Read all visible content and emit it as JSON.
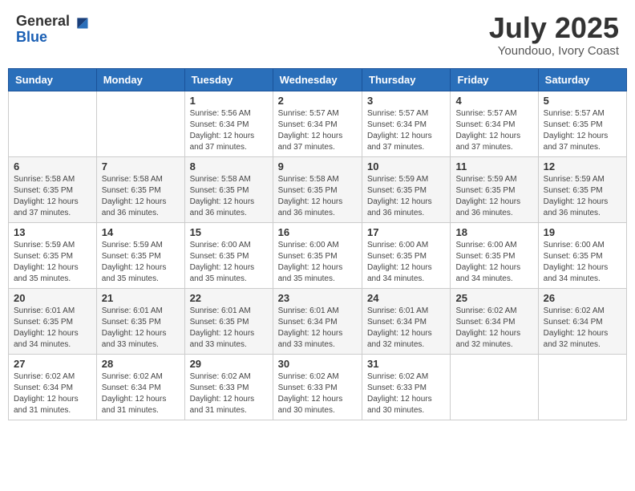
{
  "header": {
    "logo_general": "General",
    "logo_blue": "Blue",
    "month_title": "July 2025",
    "subtitle": "Youndouo, Ivory Coast"
  },
  "days_of_week": [
    "Sunday",
    "Monday",
    "Tuesday",
    "Wednesday",
    "Thursday",
    "Friday",
    "Saturday"
  ],
  "weeks": [
    [
      {
        "day": "",
        "info": ""
      },
      {
        "day": "",
        "info": ""
      },
      {
        "day": "1",
        "info": "Sunrise: 5:56 AM\nSunset: 6:34 PM\nDaylight: 12 hours and 37 minutes."
      },
      {
        "day": "2",
        "info": "Sunrise: 5:57 AM\nSunset: 6:34 PM\nDaylight: 12 hours and 37 minutes."
      },
      {
        "day": "3",
        "info": "Sunrise: 5:57 AM\nSunset: 6:34 PM\nDaylight: 12 hours and 37 minutes."
      },
      {
        "day": "4",
        "info": "Sunrise: 5:57 AM\nSunset: 6:34 PM\nDaylight: 12 hours and 37 minutes."
      },
      {
        "day": "5",
        "info": "Sunrise: 5:57 AM\nSunset: 6:35 PM\nDaylight: 12 hours and 37 minutes."
      }
    ],
    [
      {
        "day": "6",
        "info": "Sunrise: 5:58 AM\nSunset: 6:35 PM\nDaylight: 12 hours and 37 minutes."
      },
      {
        "day": "7",
        "info": "Sunrise: 5:58 AM\nSunset: 6:35 PM\nDaylight: 12 hours and 36 minutes."
      },
      {
        "day": "8",
        "info": "Sunrise: 5:58 AM\nSunset: 6:35 PM\nDaylight: 12 hours and 36 minutes."
      },
      {
        "day": "9",
        "info": "Sunrise: 5:58 AM\nSunset: 6:35 PM\nDaylight: 12 hours and 36 minutes."
      },
      {
        "day": "10",
        "info": "Sunrise: 5:59 AM\nSunset: 6:35 PM\nDaylight: 12 hours and 36 minutes."
      },
      {
        "day": "11",
        "info": "Sunrise: 5:59 AM\nSunset: 6:35 PM\nDaylight: 12 hours and 36 minutes."
      },
      {
        "day": "12",
        "info": "Sunrise: 5:59 AM\nSunset: 6:35 PM\nDaylight: 12 hours and 36 minutes."
      }
    ],
    [
      {
        "day": "13",
        "info": "Sunrise: 5:59 AM\nSunset: 6:35 PM\nDaylight: 12 hours and 35 minutes."
      },
      {
        "day": "14",
        "info": "Sunrise: 5:59 AM\nSunset: 6:35 PM\nDaylight: 12 hours and 35 minutes."
      },
      {
        "day": "15",
        "info": "Sunrise: 6:00 AM\nSunset: 6:35 PM\nDaylight: 12 hours and 35 minutes."
      },
      {
        "day": "16",
        "info": "Sunrise: 6:00 AM\nSunset: 6:35 PM\nDaylight: 12 hours and 35 minutes."
      },
      {
        "day": "17",
        "info": "Sunrise: 6:00 AM\nSunset: 6:35 PM\nDaylight: 12 hours and 34 minutes."
      },
      {
        "day": "18",
        "info": "Sunrise: 6:00 AM\nSunset: 6:35 PM\nDaylight: 12 hours and 34 minutes."
      },
      {
        "day": "19",
        "info": "Sunrise: 6:00 AM\nSunset: 6:35 PM\nDaylight: 12 hours and 34 minutes."
      }
    ],
    [
      {
        "day": "20",
        "info": "Sunrise: 6:01 AM\nSunset: 6:35 PM\nDaylight: 12 hours and 34 minutes."
      },
      {
        "day": "21",
        "info": "Sunrise: 6:01 AM\nSunset: 6:35 PM\nDaylight: 12 hours and 33 minutes."
      },
      {
        "day": "22",
        "info": "Sunrise: 6:01 AM\nSunset: 6:35 PM\nDaylight: 12 hours and 33 minutes."
      },
      {
        "day": "23",
        "info": "Sunrise: 6:01 AM\nSunset: 6:34 PM\nDaylight: 12 hours and 33 minutes."
      },
      {
        "day": "24",
        "info": "Sunrise: 6:01 AM\nSunset: 6:34 PM\nDaylight: 12 hours and 32 minutes."
      },
      {
        "day": "25",
        "info": "Sunrise: 6:02 AM\nSunset: 6:34 PM\nDaylight: 12 hours and 32 minutes."
      },
      {
        "day": "26",
        "info": "Sunrise: 6:02 AM\nSunset: 6:34 PM\nDaylight: 12 hours and 32 minutes."
      }
    ],
    [
      {
        "day": "27",
        "info": "Sunrise: 6:02 AM\nSunset: 6:34 PM\nDaylight: 12 hours and 31 minutes."
      },
      {
        "day": "28",
        "info": "Sunrise: 6:02 AM\nSunset: 6:34 PM\nDaylight: 12 hours and 31 minutes."
      },
      {
        "day": "29",
        "info": "Sunrise: 6:02 AM\nSunset: 6:33 PM\nDaylight: 12 hours and 31 minutes."
      },
      {
        "day": "30",
        "info": "Sunrise: 6:02 AM\nSunset: 6:33 PM\nDaylight: 12 hours and 30 minutes."
      },
      {
        "day": "31",
        "info": "Sunrise: 6:02 AM\nSunset: 6:33 PM\nDaylight: 12 hours and 30 minutes."
      },
      {
        "day": "",
        "info": ""
      },
      {
        "day": "",
        "info": ""
      }
    ]
  ]
}
